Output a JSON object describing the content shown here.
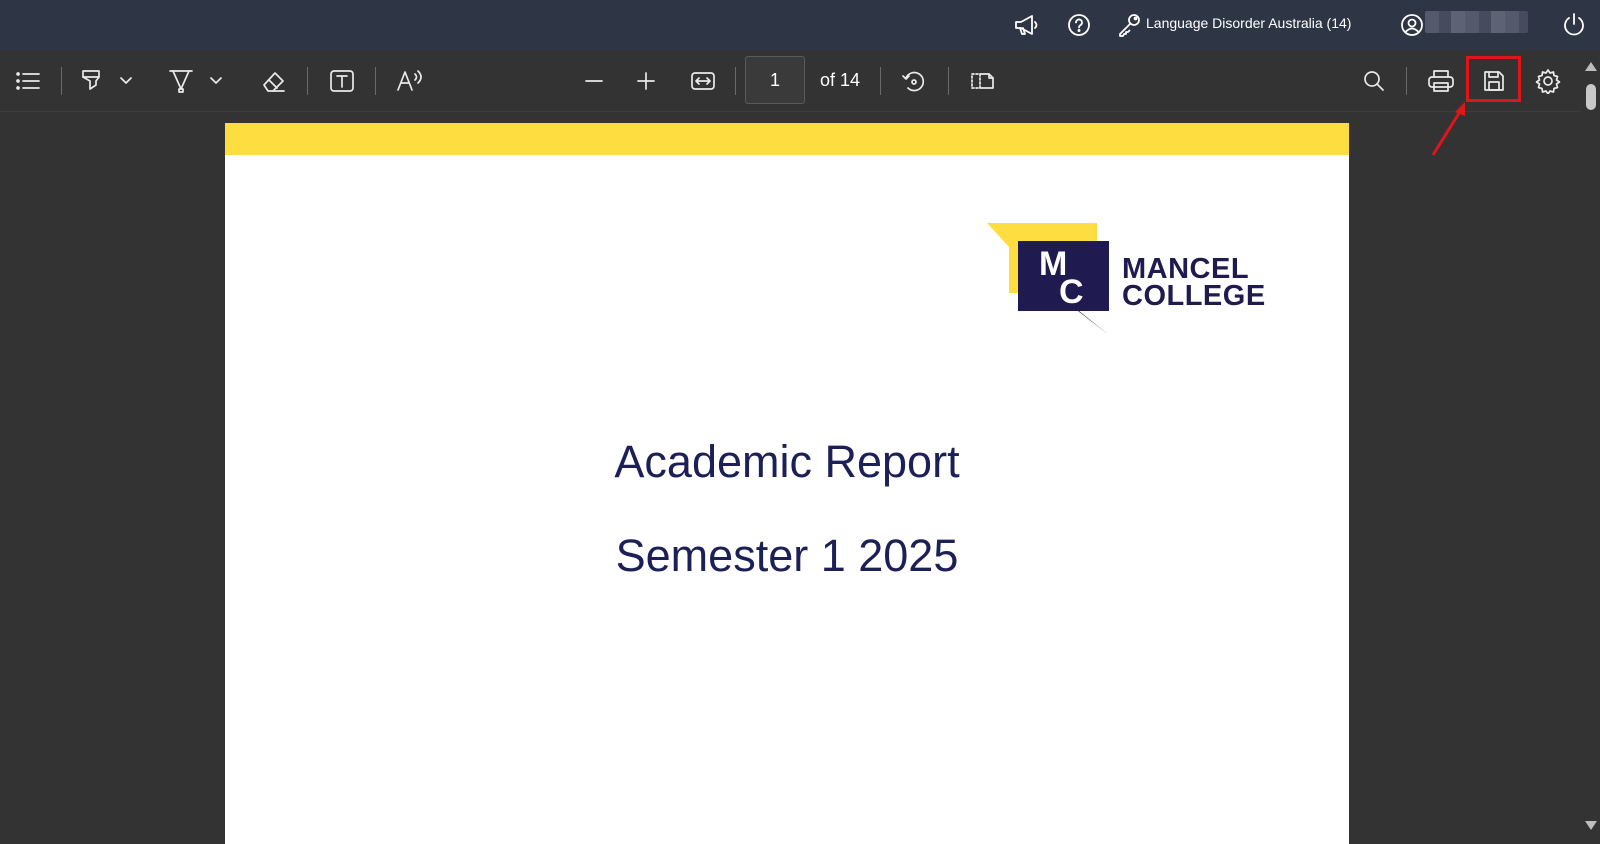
{
  "topbar": {
    "org_label": "Language Disorder Australia (14)",
    "icons": [
      "megaphone-icon",
      "help-icon",
      "key-icon",
      "user-icon",
      "power-icon"
    ]
  },
  "toolbar": {
    "icons": [
      "outline-icon",
      "highlight-icon",
      "draw-icon",
      "eraser-icon",
      "text-box-icon",
      "read-aloud-icon",
      "zoom-out-icon",
      "zoom-in-icon",
      "fit-width-icon",
      "rotate-icon",
      "page-view-icon",
      "search-icon",
      "print-icon",
      "save-icon",
      "settings-icon"
    ],
    "current_page": "1",
    "page_total": "of 14"
  },
  "document": {
    "logo_text_line1": "MANCEL",
    "logo_text_line2": "COLLEGE",
    "logo_monogram": "MC",
    "title": "Academic Report",
    "subtitle": "Semester 1 2025"
  },
  "colors": {
    "topbar_bg": "#2e3545",
    "toolbar_bg": "#333333",
    "page_band": "#fddd3f",
    "logo_navy": "#1f1a4f",
    "title_color": "#1d1f57",
    "annotation_red": "#e0151a"
  }
}
